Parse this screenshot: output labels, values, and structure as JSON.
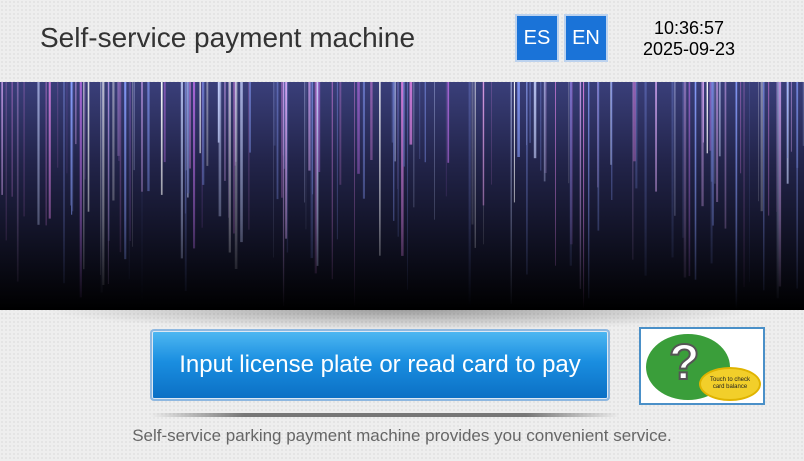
{
  "header": {
    "title": "Self-service payment machine",
    "languages": [
      {
        "code": "ES"
      },
      {
        "code": "EN"
      }
    ],
    "time": "10:36:57",
    "date": "2025-09-23"
  },
  "main": {
    "pay_button_label": "Input license plate or read card to pay",
    "help": {
      "question_mark": "?",
      "oval_text": "Touch to check card balance"
    }
  },
  "footer": {
    "text": "Self-service parking payment machine provides you convenient service."
  },
  "colors": {
    "accent_blue": "#1a73d8",
    "help_green": "#3a9e3a",
    "help_yellow": "#f2cf2a"
  },
  "icons": {
    "banner": "purple-light-streaks-banner",
    "help": "question-mark-icon"
  }
}
